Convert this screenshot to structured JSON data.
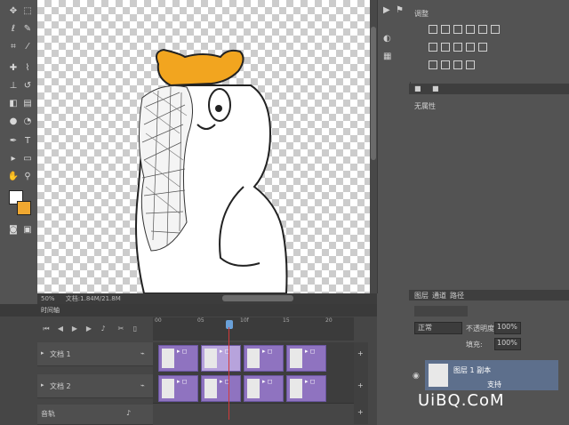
{
  "toolbar": {
    "tools": [
      "move-tool",
      "marquee-tool",
      "lasso-tool",
      "quick-select-tool",
      "crop-tool",
      "eyedropper-tool",
      "healing-tool",
      "brush-tool",
      "stamp-tool",
      "history-brush-tool",
      "eraser-tool",
      "gradient-tool",
      "blur-tool",
      "dodge-tool",
      "pen-tool",
      "type-tool",
      "path-select-tool",
      "shape-tool",
      "hand-tool",
      "zoom-tool"
    ],
    "foreground_color": "#ffffff",
    "background_color": "#f0a830"
  },
  "statusbar": {
    "zoom": "50%",
    "doc_info": "文档:1.84M/21.8M"
  },
  "timeline": {
    "title": "时间轴",
    "ruler_ticks": [
      "00",
      "05",
      "10f",
      "15",
      "20"
    ],
    "tracks": [
      {
        "name": "文档 1"
      },
      {
        "name": "文档 2"
      }
    ],
    "audio_track": "音轨"
  },
  "panels": {
    "adjustments_tab": "调整",
    "panel2_tab_a": "■",
    "panel2_tab_b": "■",
    "panel2_label": "无属性",
    "layers_tabs": [
      "图层",
      "通道",
      "路径"
    ],
    "blend_mode": "正常",
    "opacity_label": "不透明度:",
    "opacity_value": "100%",
    "fill_label": "填充:",
    "fill_value": "100%",
    "layer_name": "图层 1 副本",
    "layer_sub": "支持"
  },
  "watermark": "UiBQ.CoM",
  "colors": {
    "bear_orange": "#f2a51f",
    "clip_purple": "#8f73c0",
    "playhead_blue": "#6aa0d8",
    "selected_layer": "#5d6f8c"
  }
}
